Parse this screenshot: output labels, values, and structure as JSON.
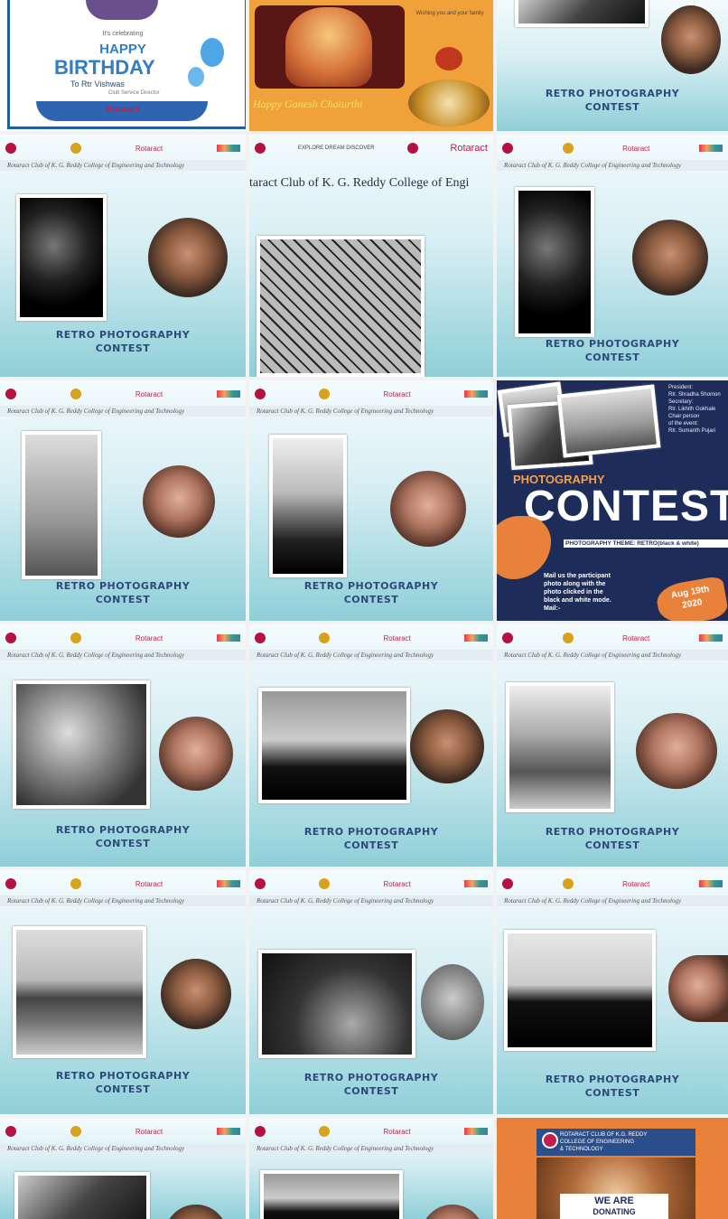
{
  "birthday": {
    "kicker": "It's celebrating",
    "line1": "HAPPY",
    "line2": "BIRTHDAY",
    "name": "To Rtr Vishwas",
    "sub": "Club Service Director",
    "logo": "Rotaract"
  },
  "ganesh": {
    "greeting": "Happy Ganesh Chaturthi",
    "info": "Wishing you and your family"
  },
  "club_name": "Rotaract Club of K. G. Reddy College of Engineering and Technology",
  "club_name_large": "taract Club of K. G. Reddy College of Engi",
  "contest_title": [
    "RETRO PHOTOGRAPHY",
    "CONTEST"
  ],
  "logos": {
    "brand": "Rotaract",
    "explore": "EXPLORE DREAM DISCOVER"
  },
  "poster": {
    "heading": "PHOTOGRAPHY",
    "big": "CONTEST",
    "theme": "PHOTOGRAPHY THEME: RETRO(black & white)",
    "info": [
      "President:",
      "Rtr. Shradha Shomon",
      "Secretary:",
      "Rtr. Likhith Gokhale",
      "Chair person",
      "of the event:",
      "Rtr. Sumanth Pujari"
    ],
    "mail": [
      "Mail us the participant",
      "photo along with the",
      "photo clicked in the",
      "black and white mode.",
      "Mail:-"
    ],
    "date": [
      "Aug 19th",
      "2020"
    ]
  },
  "donate": {
    "header": [
      "ROTARACT CLUB OF K.G. REDDY",
      "COLLEGE OF ENGINEERING",
      "& TECHNOLOGY"
    ],
    "line1": "WE ARE",
    "line2": "DONATING"
  },
  "colors": {
    "teal": "#8fcfd8",
    "title_blue": "#2b4a7a",
    "navy": "#1e2c5a",
    "orange": "#e8823a"
  }
}
